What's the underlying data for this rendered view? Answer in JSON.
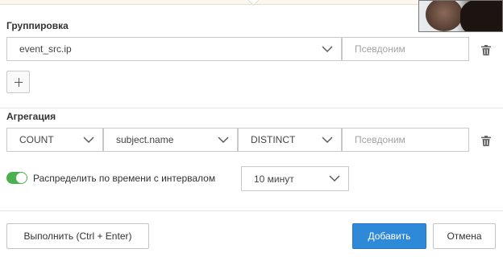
{
  "grouping": {
    "label": "Группировка",
    "field_value": "event_src.ip",
    "alias_placeholder": "Псевдоним",
    "add_button_label": "+"
  },
  "aggregation": {
    "label": "Агрегация",
    "function_value": "COUNT",
    "field_value": "subject.name",
    "modifier_value": "DISTINCT",
    "alias_placeholder": "Псевдоним"
  },
  "interval": {
    "toggle_on": true,
    "label": "Распределить по времени с интервалом",
    "value": "10 минут"
  },
  "footer": {
    "run_label": "Выполнить (Ctrl + Enter)",
    "add_label": "Добавить",
    "cancel_label": "Отмена"
  },
  "colors": {
    "primary": "#2e8ad8",
    "toggle_on": "#4caf50"
  },
  "icons": {
    "trash": "trash-icon",
    "chevron": "chevron-down-icon",
    "plus": "plus-icon"
  }
}
